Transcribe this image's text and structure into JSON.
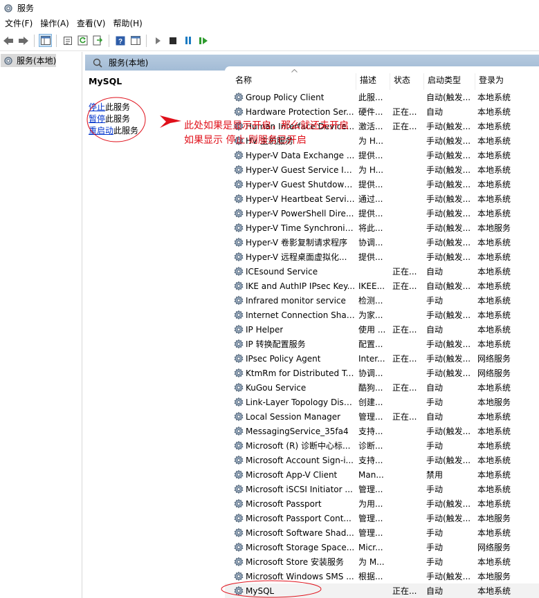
{
  "window": {
    "title": "服务"
  },
  "menu": [
    "文件(F)",
    "操作(A)",
    "查看(V)",
    "帮助(H)"
  ],
  "tree": {
    "item": "服务(本地)"
  },
  "panel": {
    "header": "服务(本地)",
    "selected_service": "MySQL",
    "actions": [
      {
        "link": "停止",
        "rest": "此服务"
      },
      {
        "link": "暂停",
        "rest": "此服务"
      },
      {
        "link": "重启动",
        "rest": "此服务"
      }
    ]
  },
  "columns": {
    "name": "名称",
    "desc": "描述",
    "status": "状态",
    "startup": "启动类型",
    "logon": "登录为"
  },
  "services": [
    {
      "name": "Group Policy Client",
      "desc": "此服...",
      "status": "",
      "startup": "自动(触发...",
      "logon": "本地系统"
    },
    {
      "name": "Hardware Protection Ser...",
      "desc": "硬件...",
      "status": "正在...",
      "startup": "自动",
      "logon": "本地系统"
    },
    {
      "name": "Human Interface Device...",
      "desc": "激活...",
      "status": "正在...",
      "startup": "手动(触发...",
      "logon": "本地系统"
    },
    {
      "name": "HV 主机服务",
      "desc": "为 H...",
      "status": "",
      "startup": "手动(触发...",
      "logon": "本地系统"
    },
    {
      "name": "Hyper-V Data Exchange ...",
      "desc": "提供...",
      "status": "",
      "startup": "手动(触发...",
      "logon": "本地系统"
    },
    {
      "name": "Hyper-V Guest Service In...",
      "desc": "为 H...",
      "status": "",
      "startup": "手动(触发...",
      "logon": "本地系统"
    },
    {
      "name": "Hyper-V Guest Shutdown...",
      "desc": "提供...",
      "status": "",
      "startup": "手动(触发...",
      "logon": "本地系统"
    },
    {
      "name": "Hyper-V Heartbeat Service",
      "desc": "通过...",
      "status": "",
      "startup": "手动(触发...",
      "logon": "本地系统"
    },
    {
      "name": "Hyper-V PowerShell Dire...",
      "desc": "提供...",
      "status": "",
      "startup": "手动(触发...",
      "logon": "本地系统"
    },
    {
      "name": "Hyper-V Time Synchroniz...",
      "desc": "将此...",
      "status": "",
      "startup": "手动(触发...",
      "logon": "本地服务"
    },
    {
      "name": "Hyper-V 卷影复制请求程序",
      "desc": "协调...",
      "status": "",
      "startup": "手动(触发...",
      "logon": "本地系统"
    },
    {
      "name": "Hyper-V 远程桌面虚拟化...",
      "desc": "提供...",
      "status": "",
      "startup": "手动(触发...",
      "logon": "本地系统"
    },
    {
      "name": "ICEsound Service",
      "desc": "",
      "status": "正在...",
      "startup": "自动",
      "logon": "本地系统"
    },
    {
      "name": "IKE and AuthIP IPsec Key...",
      "desc": "IKEE...",
      "status": "正在...",
      "startup": "自动(触发...",
      "logon": "本地系统"
    },
    {
      "name": "Infrared monitor service",
      "desc": "检测...",
      "status": "",
      "startup": "手动",
      "logon": "本地系统"
    },
    {
      "name": "Internet Connection Shari...",
      "desc": "为家...",
      "status": "",
      "startup": "手动(触发...",
      "logon": "本地系统"
    },
    {
      "name": "IP Helper",
      "desc": "使用 ...",
      "status": "正在...",
      "startup": "自动",
      "logon": "本地系统"
    },
    {
      "name": "IP 转换配置服务",
      "desc": "配置...",
      "status": "",
      "startup": "手动(触发...",
      "logon": "本地系统"
    },
    {
      "name": "IPsec Policy Agent",
      "desc": "Inter...",
      "status": "正在...",
      "startup": "手动(触发...",
      "logon": "网络服务"
    },
    {
      "name": "KtmRm for Distributed Tr...",
      "desc": "协调...",
      "status": "",
      "startup": "手动(触发...",
      "logon": "网络服务"
    },
    {
      "name": "KuGou Service",
      "desc": "酷狗...",
      "status": "正在...",
      "startup": "自动",
      "logon": "本地系统"
    },
    {
      "name": "Link-Layer Topology Disc...",
      "desc": "创建...",
      "status": "",
      "startup": "手动",
      "logon": "本地服务"
    },
    {
      "name": "Local Session Manager",
      "desc": "管理...",
      "status": "正在...",
      "startup": "自动",
      "logon": "本地系统"
    },
    {
      "name": "MessagingService_35fa4",
      "desc": "支持...",
      "status": "",
      "startup": "手动(触发...",
      "logon": "本地系统"
    },
    {
      "name": "Microsoft (R) 诊断中心标...",
      "desc": "诊断...",
      "status": "",
      "startup": "手动",
      "logon": "本地系统"
    },
    {
      "name": "Microsoft Account Sign-i...",
      "desc": "支持...",
      "status": "",
      "startup": "手动(触发...",
      "logon": "本地系统"
    },
    {
      "name": "Microsoft App-V Client",
      "desc": "Man...",
      "status": "",
      "startup": "禁用",
      "logon": "本地系统"
    },
    {
      "name": "Microsoft iSCSI Initiator ...",
      "desc": "管理...",
      "status": "",
      "startup": "手动",
      "logon": "本地系统"
    },
    {
      "name": "Microsoft Passport",
      "desc": "为用...",
      "status": "",
      "startup": "手动(触发...",
      "logon": "本地系统"
    },
    {
      "name": "Microsoft Passport Cont...",
      "desc": "管理...",
      "status": "",
      "startup": "手动(触发...",
      "logon": "本地服务"
    },
    {
      "name": "Microsoft Software Shad...",
      "desc": "管理...",
      "status": "",
      "startup": "手动",
      "logon": "本地系统"
    },
    {
      "name": "Microsoft Storage Space...",
      "desc": "Micr...",
      "status": "",
      "startup": "手动",
      "logon": "网络服务"
    },
    {
      "name": "Microsoft Store 安装服务",
      "desc": "为 M...",
      "status": "",
      "startup": "手动",
      "logon": "本地系统"
    },
    {
      "name": "Microsoft Windows SMS ...",
      "desc": "根据...",
      "status": "",
      "startup": "手动(触发...",
      "logon": "本地服务"
    },
    {
      "name": "MySQL",
      "desc": "",
      "status": "正在...",
      "startup": "自动",
      "logon": "本地系统"
    }
  ],
  "annotation": {
    "line1": "此处如果是显示开启，那么就还未开启",
    "line2": "如果显示 停止 则服务已开启",
    "color": "#e0101a"
  }
}
